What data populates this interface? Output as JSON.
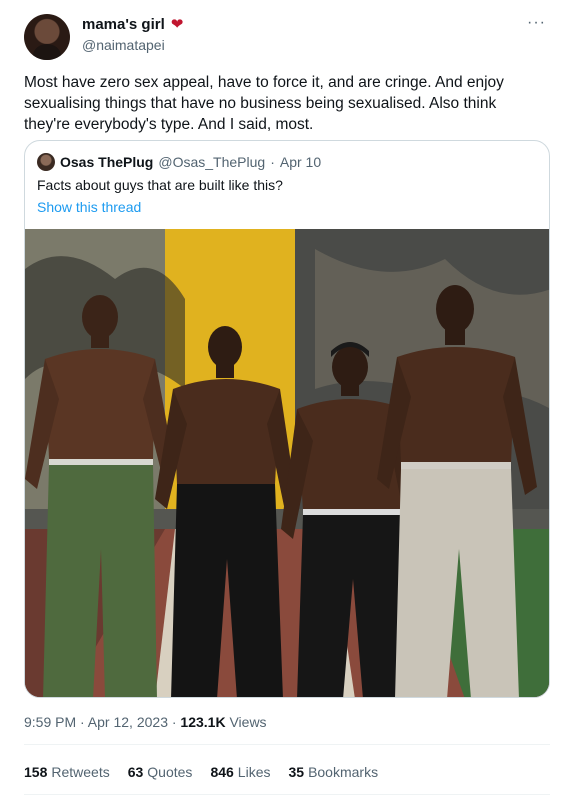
{
  "author": {
    "display_name": "mama's girl",
    "handle": "@naimatapei",
    "heart": "❤"
  },
  "tweet": {
    "text": "Most have zero sex appeal, have to force it, and are cringe. And enjoy sexualising things that have no business being sexualised. Also think they're everybody's type. And I said, most."
  },
  "more_icon": "···",
  "quote": {
    "name": "Osas ThePlug",
    "handle": "@Osas_ThePlug",
    "separator": "·",
    "date": "Apr 10",
    "text": "Facts about guys that are built like this?",
    "show_thread": "Show this thread"
  },
  "meta": {
    "time": "9:59 PM · Apr 12, 2023 · ",
    "views_count": "123.1K",
    "views_label": " Views"
  },
  "stats": [
    {
      "count": "158",
      "label": "Retweets"
    },
    {
      "count": "63",
      "label": "Quotes"
    },
    {
      "count": "846",
      "label": "Likes"
    },
    {
      "count": "35",
      "label": "Bookmarks"
    }
  ],
  "colors": {
    "link": "#1d9bf0",
    "secondary_text": "#536471",
    "primary_text": "#0f1419",
    "heart": "#c0152f"
  }
}
